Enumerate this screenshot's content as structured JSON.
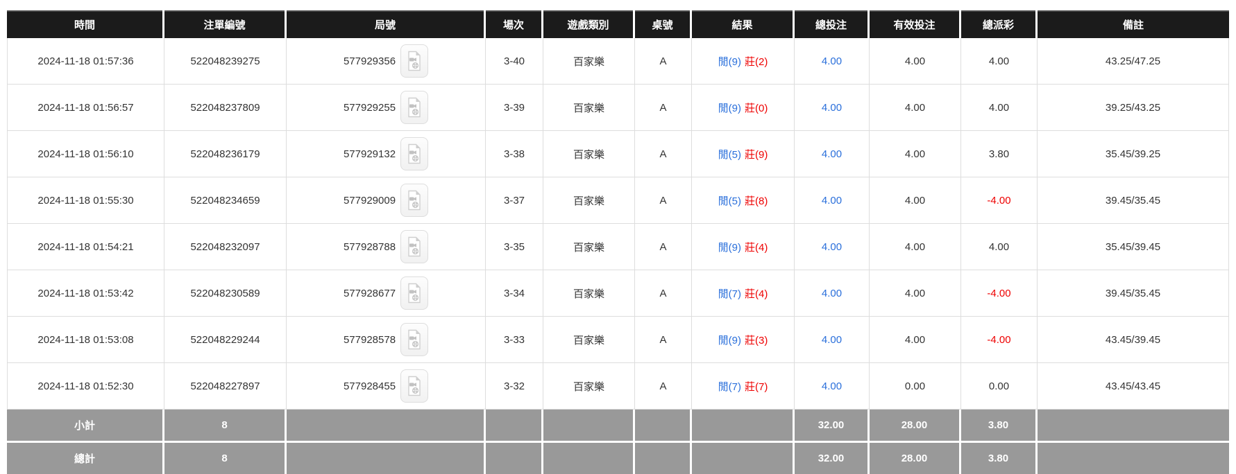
{
  "table": {
    "columns": {
      "time": "時間",
      "bet_no": "注單編號",
      "round_no": "局號",
      "session": "場次",
      "game_type": "遊戲類別",
      "table_no": "桌號",
      "result": "結果",
      "total_bet": "總投注",
      "valid_bet": "有效投注",
      "total_payout": "總派彩",
      "remark": "備註"
    },
    "rows": [
      {
        "time": "2024-11-18 01:57:36",
        "bet_no": "522048239275",
        "round_no": "577929356",
        "session": "3-40",
        "game_type": "百家樂",
        "table_no": "A",
        "result_player": "閒(9)",
        "result_banker": "莊(2)",
        "total_bet": "4.00",
        "valid_bet": "4.00",
        "total_payout": "4.00",
        "payout_class": "payout-pos",
        "remark": "43.25/47.25"
      },
      {
        "time": "2024-11-18 01:56:57",
        "bet_no": "522048237809",
        "round_no": "577929255",
        "session": "3-39",
        "game_type": "百家樂",
        "table_no": "A",
        "result_player": "閒(9)",
        "result_banker": "莊(0)",
        "total_bet": "4.00",
        "valid_bet": "4.00",
        "total_payout": "4.00",
        "payout_class": "payout-pos",
        "remark": "39.25/43.25"
      },
      {
        "time": "2024-11-18 01:56:10",
        "bet_no": "522048236179",
        "round_no": "577929132",
        "session": "3-38",
        "game_type": "百家樂",
        "table_no": "A",
        "result_player": "閒(5)",
        "result_banker": "莊(9)",
        "total_bet": "4.00",
        "valid_bet": "4.00",
        "total_payout": "3.80",
        "payout_class": "payout-pos",
        "remark": "35.45/39.25"
      },
      {
        "time": "2024-11-18 01:55:30",
        "bet_no": "522048234659",
        "round_no": "577929009",
        "session": "3-37",
        "game_type": "百家樂",
        "table_no": "A",
        "result_player": "閒(5)",
        "result_banker": "莊(8)",
        "total_bet": "4.00",
        "valid_bet": "4.00",
        "total_payout": "-4.00",
        "payout_class": "payout-neg",
        "remark": "39.45/35.45"
      },
      {
        "time": "2024-11-18 01:54:21",
        "bet_no": "522048232097",
        "round_no": "577928788",
        "session": "3-35",
        "game_type": "百家樂",
        "table_no": "A",
        "result_player": "閒(9)",
        "result_banker": "莊(4)",
        "total_bet": "4.00",
        "valid_bet": "4.00",
        "total_payout": "4.00",
        "payout_class": "payout-pos",
        "remark": "35.45/39.45"
      },
      {
        "time": "2024-11-18 01:53:42",
        "bet_no": "522048230589",
        "round_no": "577928677",
        "session": "3-34",
        "game_type": "百家樂",
        "table_no": "A",
        "result_player": "閒(7)",
        "result_banker": "莊(4)",
        "total_bet": "4.00",
        "valid_bet": "4.00",
        "total_payout": "-4.00",
        "payout_class": "payout-neg",
        "remark": "39.45/35.45"
      },
      {
        "time": "2024-11-18 01:53:08",
        "bet_no": "522048229244",
        "round_no": "577928578",
        "session": "3-33",
        "game_type": "百家樂",
        "table_no": "A",
        "result_player": "閒(9)",
        "result_banker": "莊(3)",
        "total_bet": "4.00",
        "valid_bet": "4.00",
        "total_payout": "-4.00",
        "payout_class": "payout-neg",
        "remark": "43.45/39.45"
      },
      {
        "time": "2024-11-18 01:52:30",
        "bet_no": "522048227897",
        "round_no": "577928455",
        "session": "3-32",
        "game_type": "百家樂",
        "table_no": "A",
        "result_player": "閒(7)",
        "result_banker": "莊(7)",
        "total_bet": "4.00",
        "valid_bet": "0.00",
        "total_payout": "0.00",
        "payout_class": "payout-pos",
        "remark": "43.45/43.45"
      }
    ],
    "footer": {
      "subtotal": {
        "label": "小計",
        "count": "8",
        "total_bet": "32.00",
        "valid_bet": "28.00",
        "total_payout": "3.80"
      },
      "total": {
        "label": "總計",
        "count": "8",
        "total_bet": "32.00",
        "valid_bet": "28.00",
        "total_payout": "3.80"
      }
    }
  },
  "icons": {
    "round_replay": "video-replay-icon"
  },
  "colors": {
    "header_bg": "#1b1b1b",
    "footer_bg": "#999999",
    "accent_blue": "#2a6fdb",
    "accent_red": "#ee0000",
    "border_gray": "#dddddd"
  }
}
